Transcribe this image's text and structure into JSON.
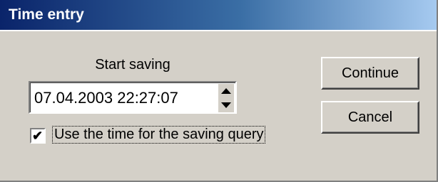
{
  "window": {
    "title": "Time entry"
  },
  "start_saving": {
    "label": "Start saving",
    "value": "07.04.2003 22:27:07"
  },
  "option": {
    "checked": true,
    "check_glyph": "✔",
    "label": "Use the time for the saving query"
  },
  "buttons": {
    "continue_label": "Continue",
    "cancel_label": "Cancel"
  },
  "colors": {
    "face": "#d4d0c8",
    "titlebar_start": "#0a246a",
    "titlebar_end": "#a6caf0"
  }
}
